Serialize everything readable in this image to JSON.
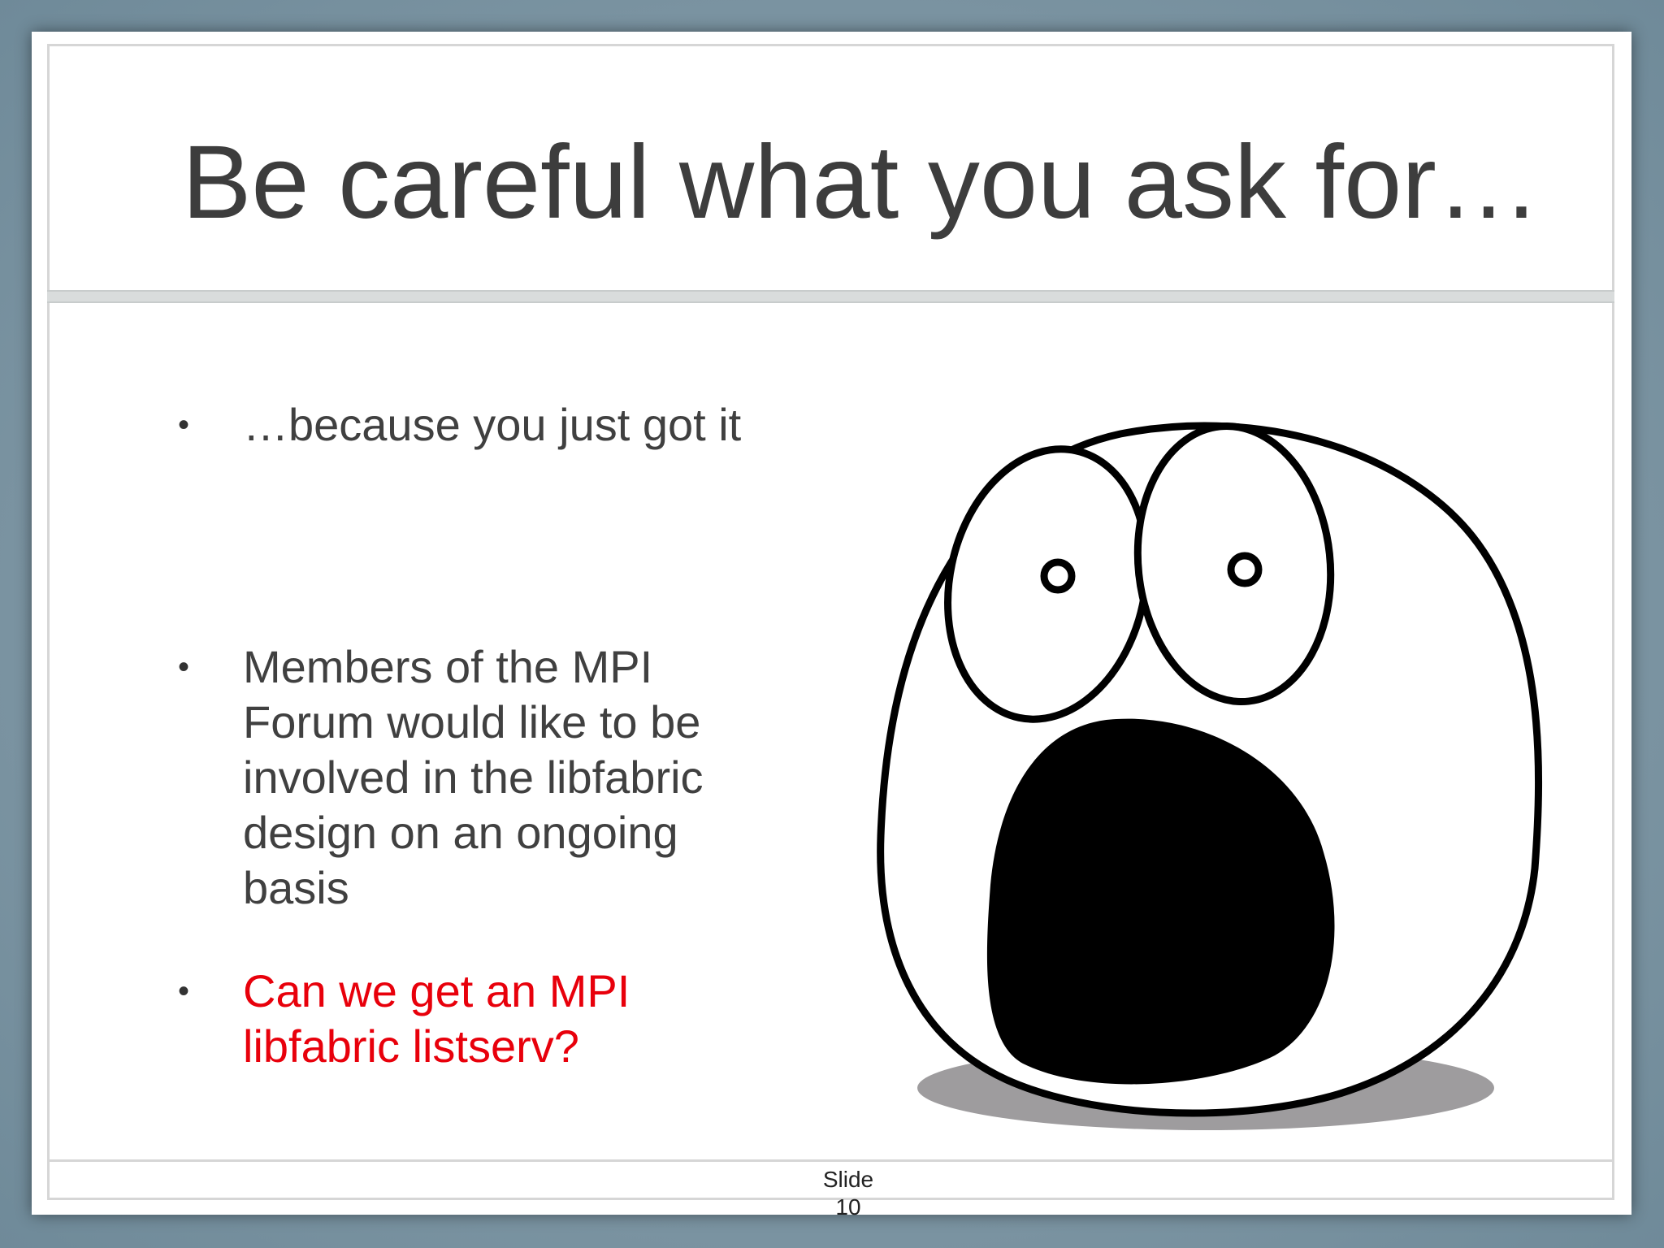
{
  "slide": {
    "title": "Be careful what you ask for…",
    "bullets": [
      {
        "text": "…because you just got it",
        "color": "#404040"
      },
      {
        "text": "Members of the MPI Forum would like to be involved in the libfabric design on an ongoing basis",
        "color": "#404040"
      },
      {
        "text": "Can we get an MPI libfabric listserv?",
        "color": "#e8000b"
      }
    ],
    "bullet_glyph": "•",
    "footer": {
      "label": "Slide",
      "number": "10"
    },
    "illustration": "shocked-face-cartoon"
  },
  "colors": {
    "background": "#7d95a3",
    "title_text": "#3d3d3d",
    "body_text": "#404040",
    "highlight": "#e8000b"
  }
}
